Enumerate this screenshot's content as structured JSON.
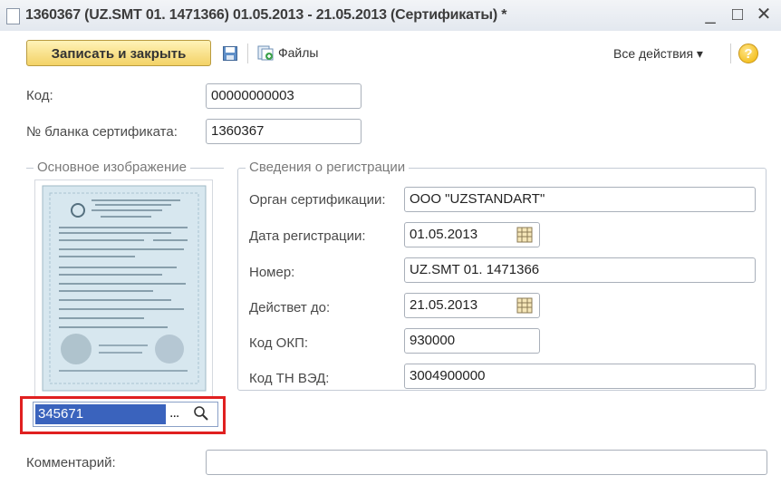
{
  "window": {
    "title": "1360367 (UZ.SMT 01.  1471366) 01.05.2013 - 21.05.2013 (Сертификаты) *",
    "minimize_glyph": "_",
    "maximize_glyph": "□",
    "close_glyph": "✕"
  },
  "toolbar": {
    "save_close_label": "Записать и закрыть",
    "files_label": "Файлы",
    "all_actions_label": "Все действия ▾",
    "help_glyph": "?"
  },
  "form": {
    "code_label": "Код:",
    "code_value": "00000000003",
    "blank_label": "№ бланка сертификата:",
    "blank_value": "1360367",
    "comment_label": "Комментарий:",
    "comment_value": ""
  },
  "image_group": {
    "title": "Основное изображение",
    "code_value": "345671",
    "select_glyph": "...",
    "search_icon": "magnifier-icon"
  },
  "registration": {
    "title": "Сведения о регистрации",
    "organ_label": "Орган сертификации:",
    "organ_value": "ООО \"UZSTANDART\"",
    "reg_date_label": "Дата регистрации:",
    "reg_date_value": "01.05.2013",
    "number_label": "Номер:",
    "number_value": "UZ.SMT 01.  1471366",
    "valid_label": "Действет до:",
    "valid_value": "21.05.2013",
    "okp_label": "Код ОКП:",
    "okp_value": "930000",
    "tnved_label": "Код ТН ВЭД:",
    "tnved_value": "3004900000"
  },
  "colors": {
    "accent_button": "#f3d266",
    "selection": "#3a63bd",
    "highlight_frame": "#e02020"
  }
}
